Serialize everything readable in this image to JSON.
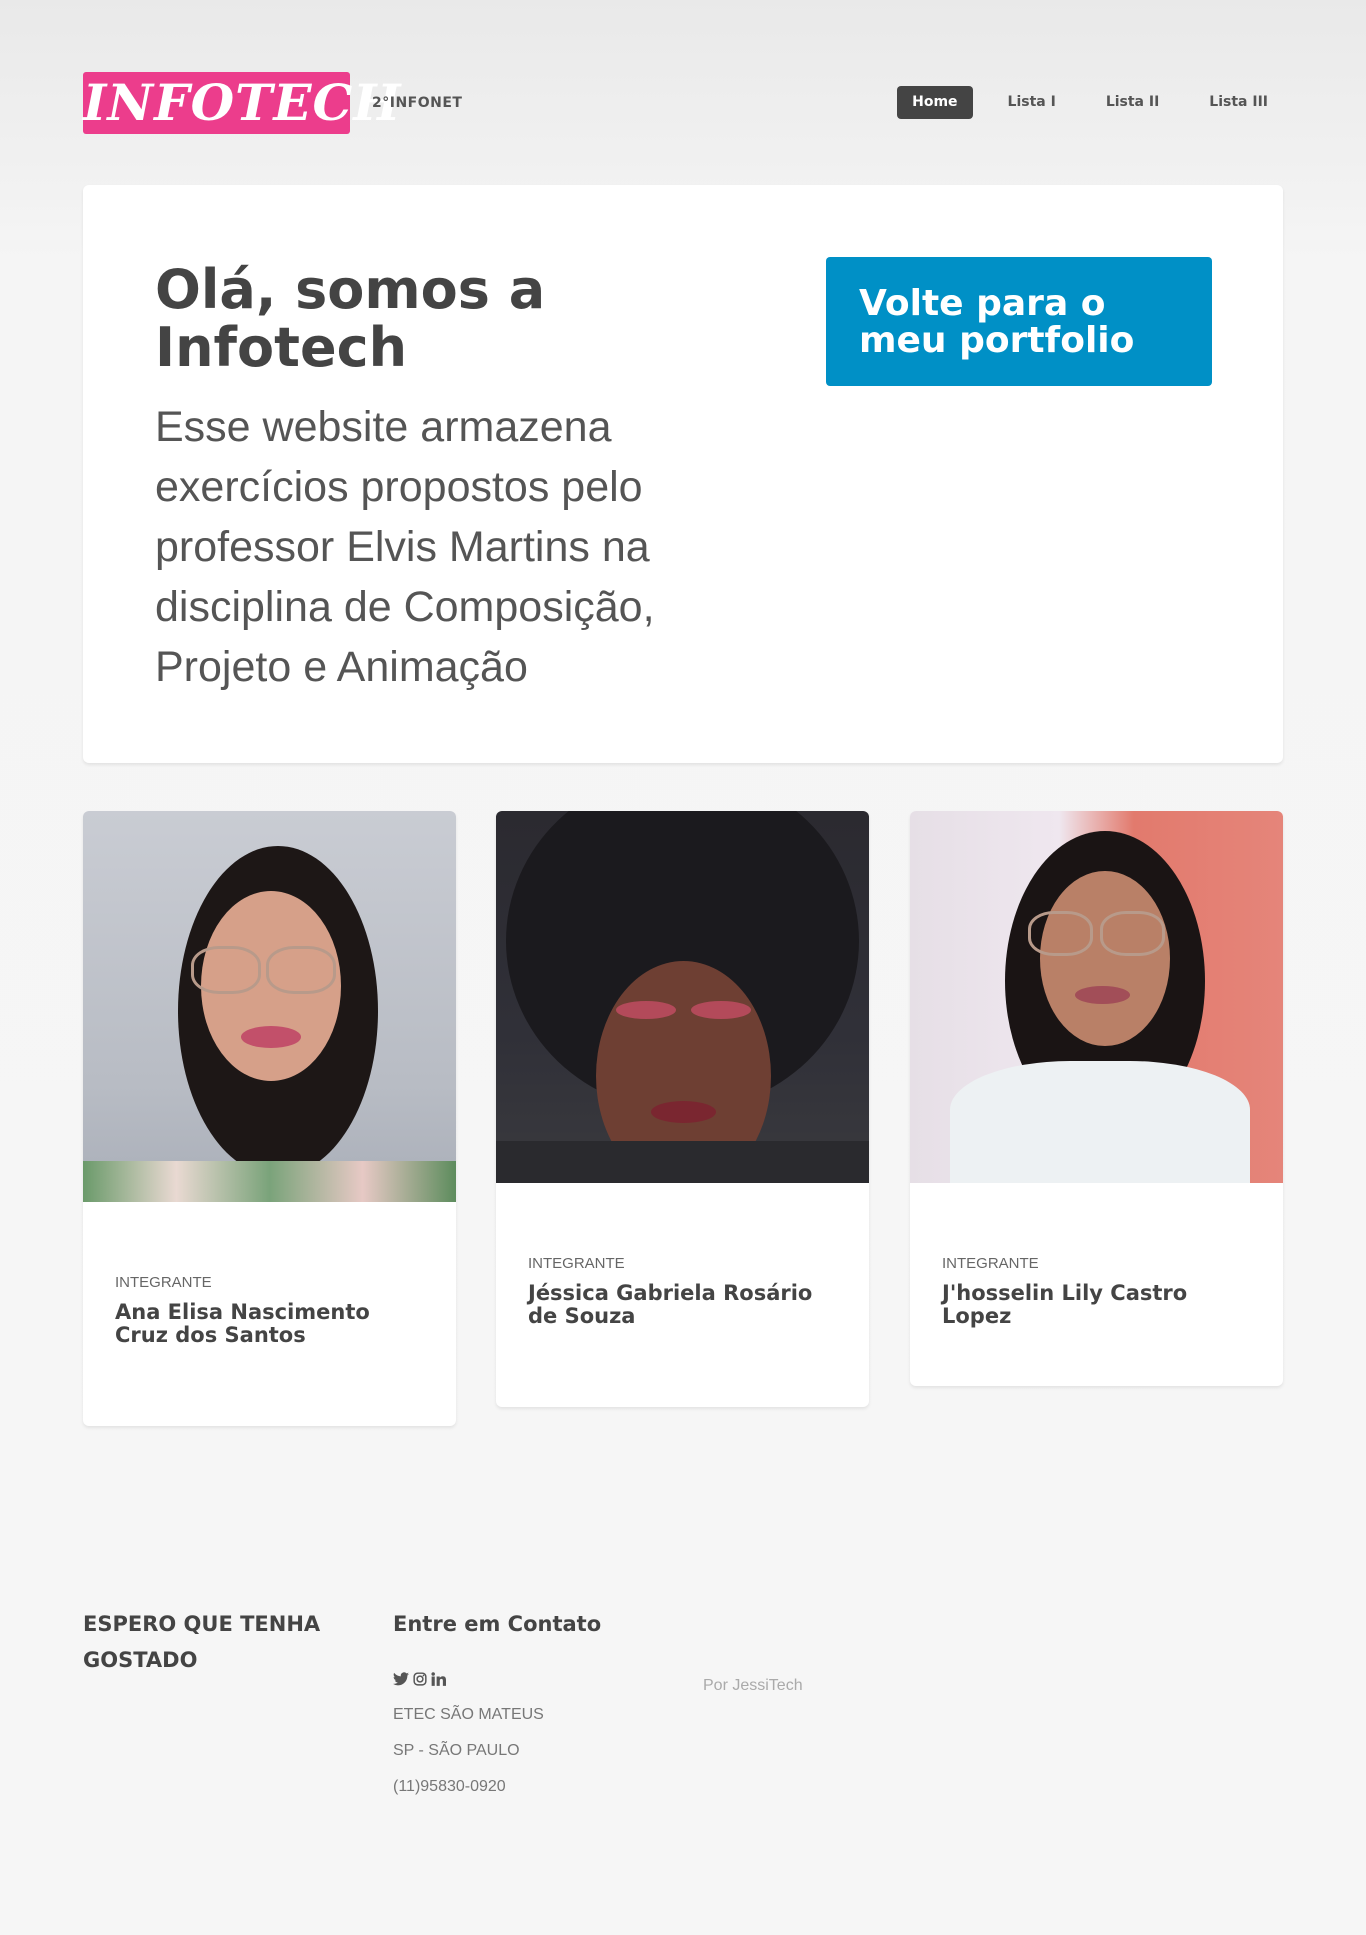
{
  "header": {
    "logo": "INFOTECH",
    "subtitle": "2°INFONET",
    "nav": [
      "Home",
      "Lista I",
      "Lista II",
      "Lista III"
    ]
  },
  "hero": {
    "title": "Olá, somos a Infotech",
    "text": "Esse website armazena exercícios propostos pelo professor Elvis Martins na disciplina de Composição, Projeto e Animação",
    "button": "Volte para o meu portfolio"
  },
  "members": [
    {
      "role": "INTEGRANTE",
      "name": "Ana Elisa Nascimento Cruz dos Santos"
    },
    {
      "role": "INTEGRANTE",
      "name": "Jéssica Gabriela Rosário de Souza"
    },
    {
      "role": "INTEGRANTE",
      "name": "J'hosselin Lily Castro Lopez"
    }
  ],
  "footer": {
    "message": "ESPERO QUE TENHA GOSTADO",
    "contact_title": "Entre em Contato",
    "social_icons": [
      "twitter-icon",
      "instagram-icon",
      "linkedin-icon"
    ],
    "school": "ETEC SÃO MATEUS",
    "city": "SP - SÃO PAULO",
    "phone": "(11)95830-0920",
    "credit": "Por JessiTech"
  },
  "colors": {
    "logo_bg": "#ec3d8c",
    "button_bg": "#0090c6",
    "nav_active_bg": "#444444"
  }
}
